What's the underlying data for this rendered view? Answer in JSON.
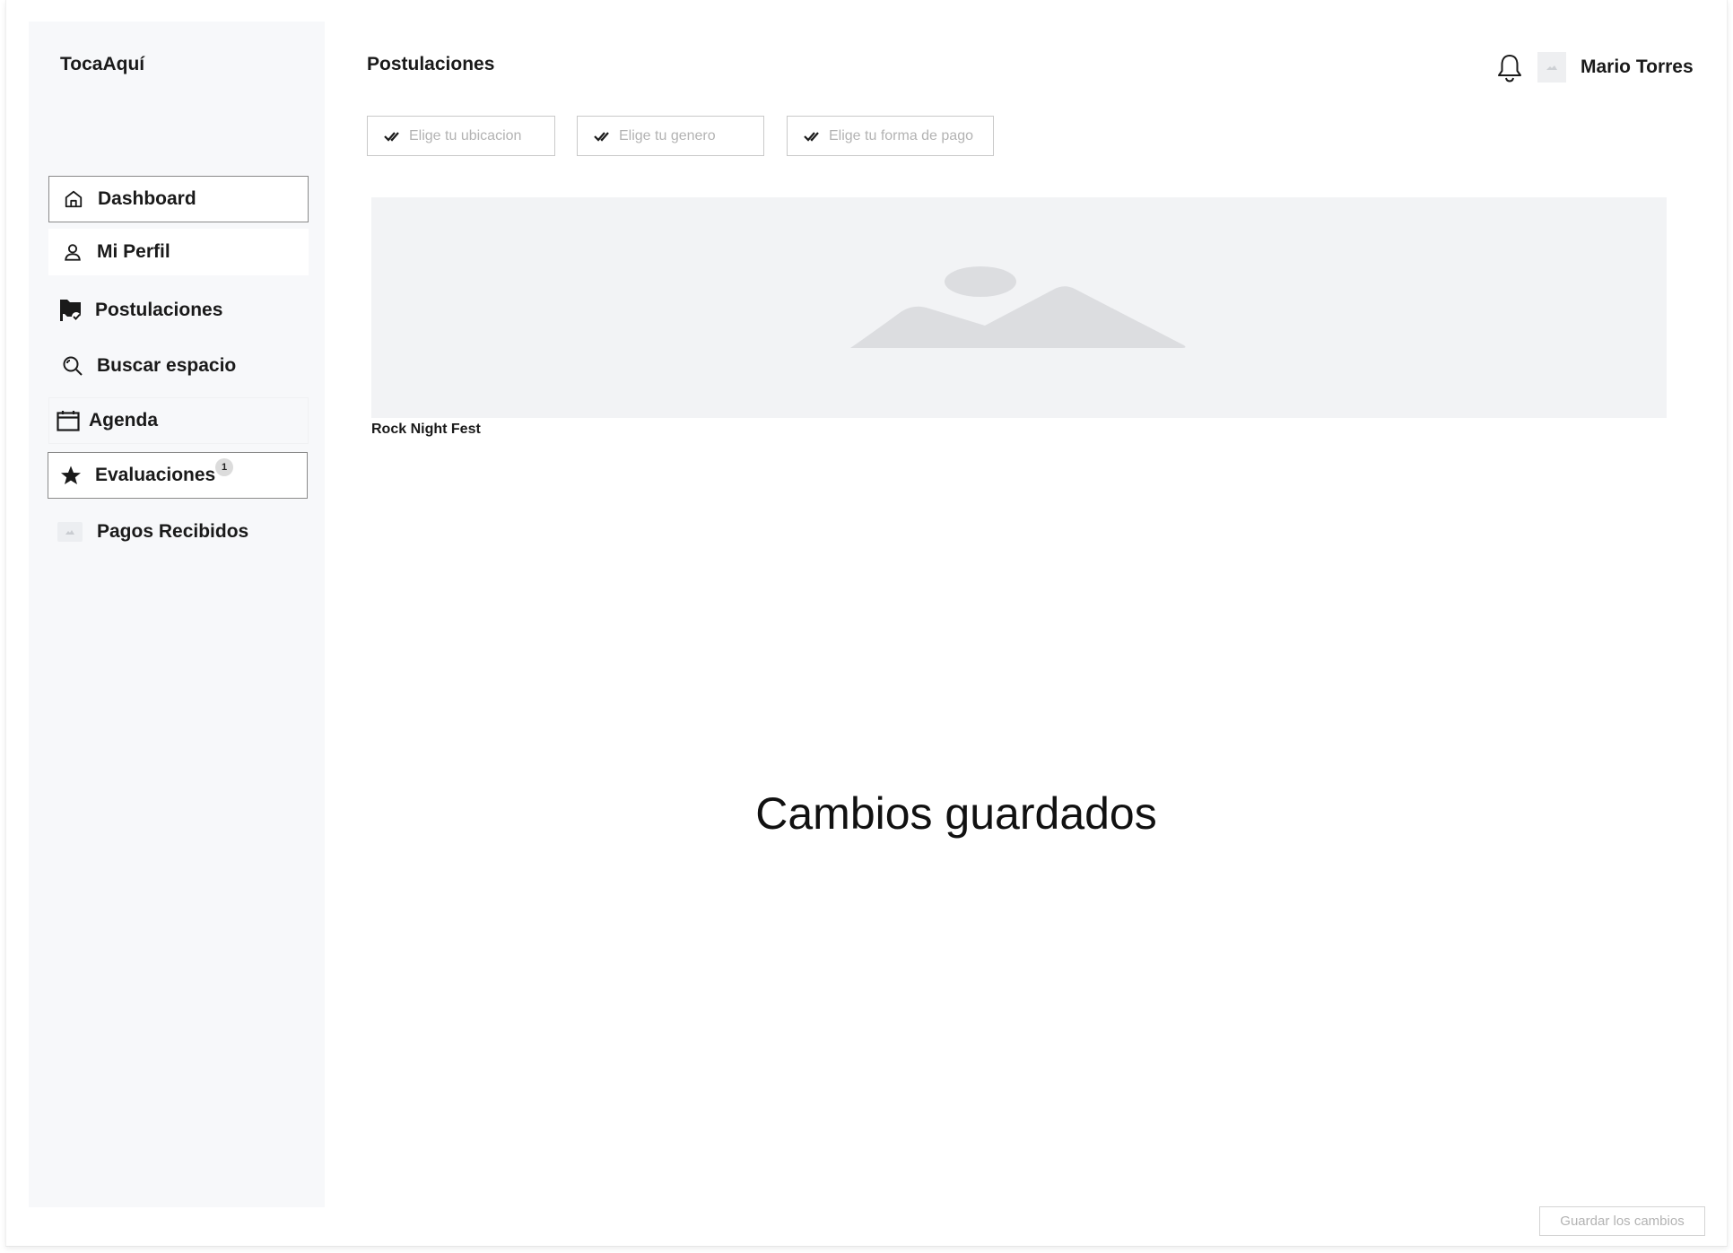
{
  "app": {
    "brand": "TocaAquí"
  },
  "sidebar": {
    "items": [
      {
        "label": "Dashboard",
        "icon": "home-icon"
      },
      {
        "label": "Mi Perfil",
        "icon": "user-icon"
      },
      {
        "label": "Postulaciones",
        "icon": "flag-check-icon"
      },
      {
        "label": "Buscar espacio",
        "icon": "search-icon"
      },
      {
        "label": "Agenda",
        "icon": "calendar-icon"
      },
      {
        "label": "Evaluaciones",
        "icon": "star-icon",
        "badge": "1"
      },
      {
        "label": "Pagos Recibidos",
        "icon": "image-placeholder-icon"
      }
    ]
  },
  "header": {
    "title": "Postulaciones",
    "user_name": "Mario Torres"
  },
  "filters": [
    {
      "placeholder": "Elige tu ubicacion"
    },
    {
      "placeholder": "Elige tu genero"
    },
    {
      "placeholder": "Elige tu forma de pago"
    }
  ],
  "event": {
    "name": "Rock Night Fest"
  },
  "toast": {
    "message": "Cambios guardados"
  },
  "footer": {
    "save_label": "Guardar los cambios"
  },
  "colors": {
    "sidebar_bg": "#f7f8fa",
    "placeholder_text": "#b3b3b3",
    "image_placeholder": "#f2f3f5"
  }
}
